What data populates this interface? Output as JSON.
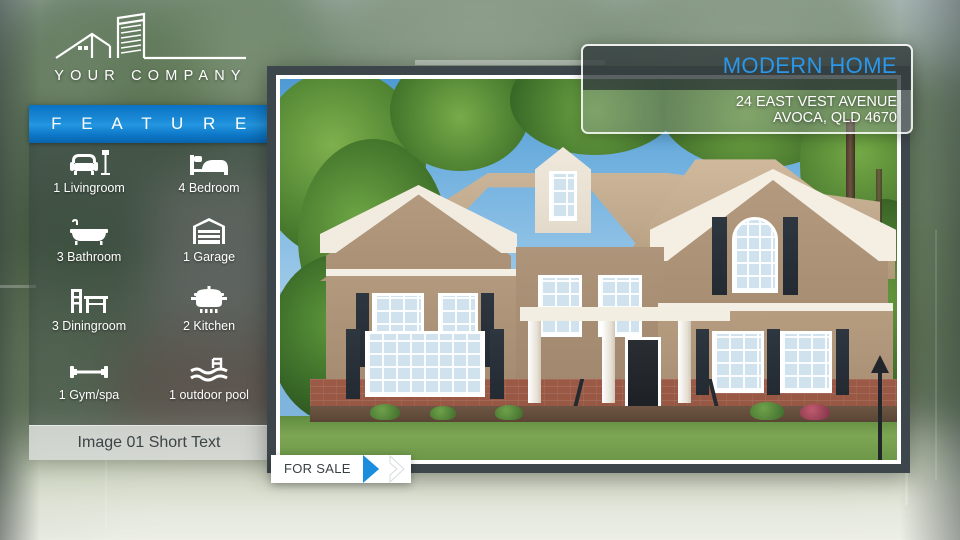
{
  "brand": {
    "name": "YOUR COMPANY",
    "logo_icon": "house-and-building-logo-icon"
  },
  "sidebar": {
    "header": "F E A T U R E",
    "header_plain": "FEATURE",
    "accent_color": "#1b8ddd",
    "features": [
      {
        "label": "1 Livingroom",
        "icon": "armchair-lamp-icon",
        "count": 1,
        "name": "Livingroom"
      },
      {
        "label": "4 Bedroom",
        "icon": "bed-icon",
        "count": 4,
        "name": "Bedroom"
      },
      {
        "label": "3 Bathroom",
        "icon": "bathtub-icon",
        "count": 3,
        "name": "Bathroom"
      },
      {
        "label": "1 Garage",
        "icon": "garage-door-icon",
        "count": 1,
        "name": "Garage"
      },
      {
        "label": "3 Diningroom",
        "icon": "dining-table-icon",
        "count": 3,
        "name": "Diningroom"
      },
      {
        "label": "2 Kitchen",
        "icon": "cooking-pot-icon",
        "count": 2,
        "name": "Kitchen"
      },
      {
        "label": "1 Gym/spa",
        "icon": "dumbbell-icon",
        "count": 1,
        "name": "Gym/spa"
      },
      {
        "label": "1 outdoor pool",
        "icon": "swimming-pool-icon",
        "count": 1,
        "name": "outdoor pool"
      }
    ],
    "caption": "Image 01 Short Text"
  },
  "info_panel": {
    "title": "MODERN HOME",
    "title_color": "#2a97ea",
    "address_line1": "24 EAST VEST AVENUE",
    "address_line2": "AVOCA, QLD 4670"
  },
  "banner": {
    "label": "FOR SALE",
    "chevron_color": "#1b8ddd",
    "chevron_icon": "chevron-right-icon"
  },
  "photo": {
    "alt": "two-story suburban house with tan siding brick facade and front porch"
  }
}
